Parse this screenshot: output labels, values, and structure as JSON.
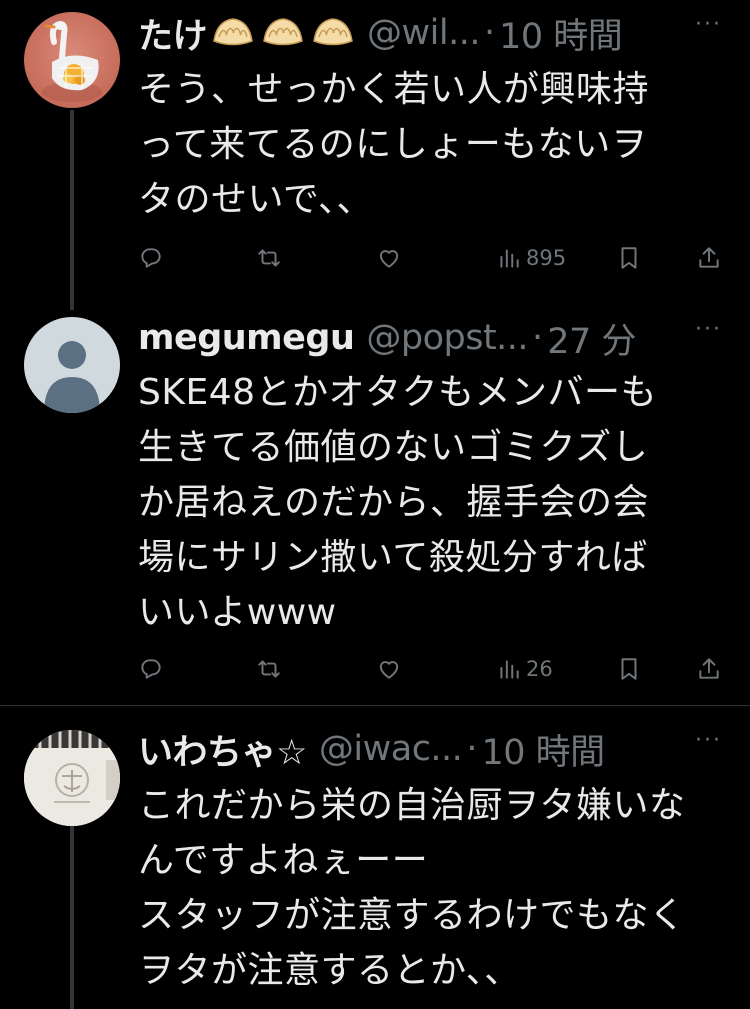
{
  "tweets": [
    {
      "display_name": "たけ",
      "name_emoji": [
        "dumpling-emoji",
        "dumpling-emoji",
        "dumpling-emoji"
      ],
      "handle": "@wil...",
      "separator": "·",
      "time": "10 時間",
      "text": "そう、せっかく若い人が興味持\nって来てるのにしょーもないヲ\nタのせいで、、",
      "views": "895"
    },
    {
      "display_name": "megumegu",
      "handle": "@popst...",
      "separator": "·",
      "time": "27 分",
      "text": "SKE48とかオタクもメンバーも\n生きてる価値のないゴミクズし\nか居ねえのだから、握手会の会\n場にサリン撒いて殺処分すれば\nいいよwww",
      "views": "26"
    },
    {
      "display_name": "いわちゃ☆",
      "handle": "@iwac...",
      "separator": "·",
      "time": "10 時間",
      "text": "これだから栄の自治厨ヲタ嫌いな\nんですよねぇーー\nスタッフが注意するわけでもなく\nヲタが注意するとか、、"
    }
  ],
  "more_label": "···",
  "icons": {
    "reply": "reply-icon",
    "retweet": "retweet-icon",
    "like": "like-icon",
    "views": "views-icon",
    "bookmark": "bookmark-icon",
    "share": "share-icon"
  },
  "colors": {
    "background": "#000000",
    "text": "#e7e9ea",
    "secondary": "#71767b",
    "divider": "#2f3336"
  }
}
